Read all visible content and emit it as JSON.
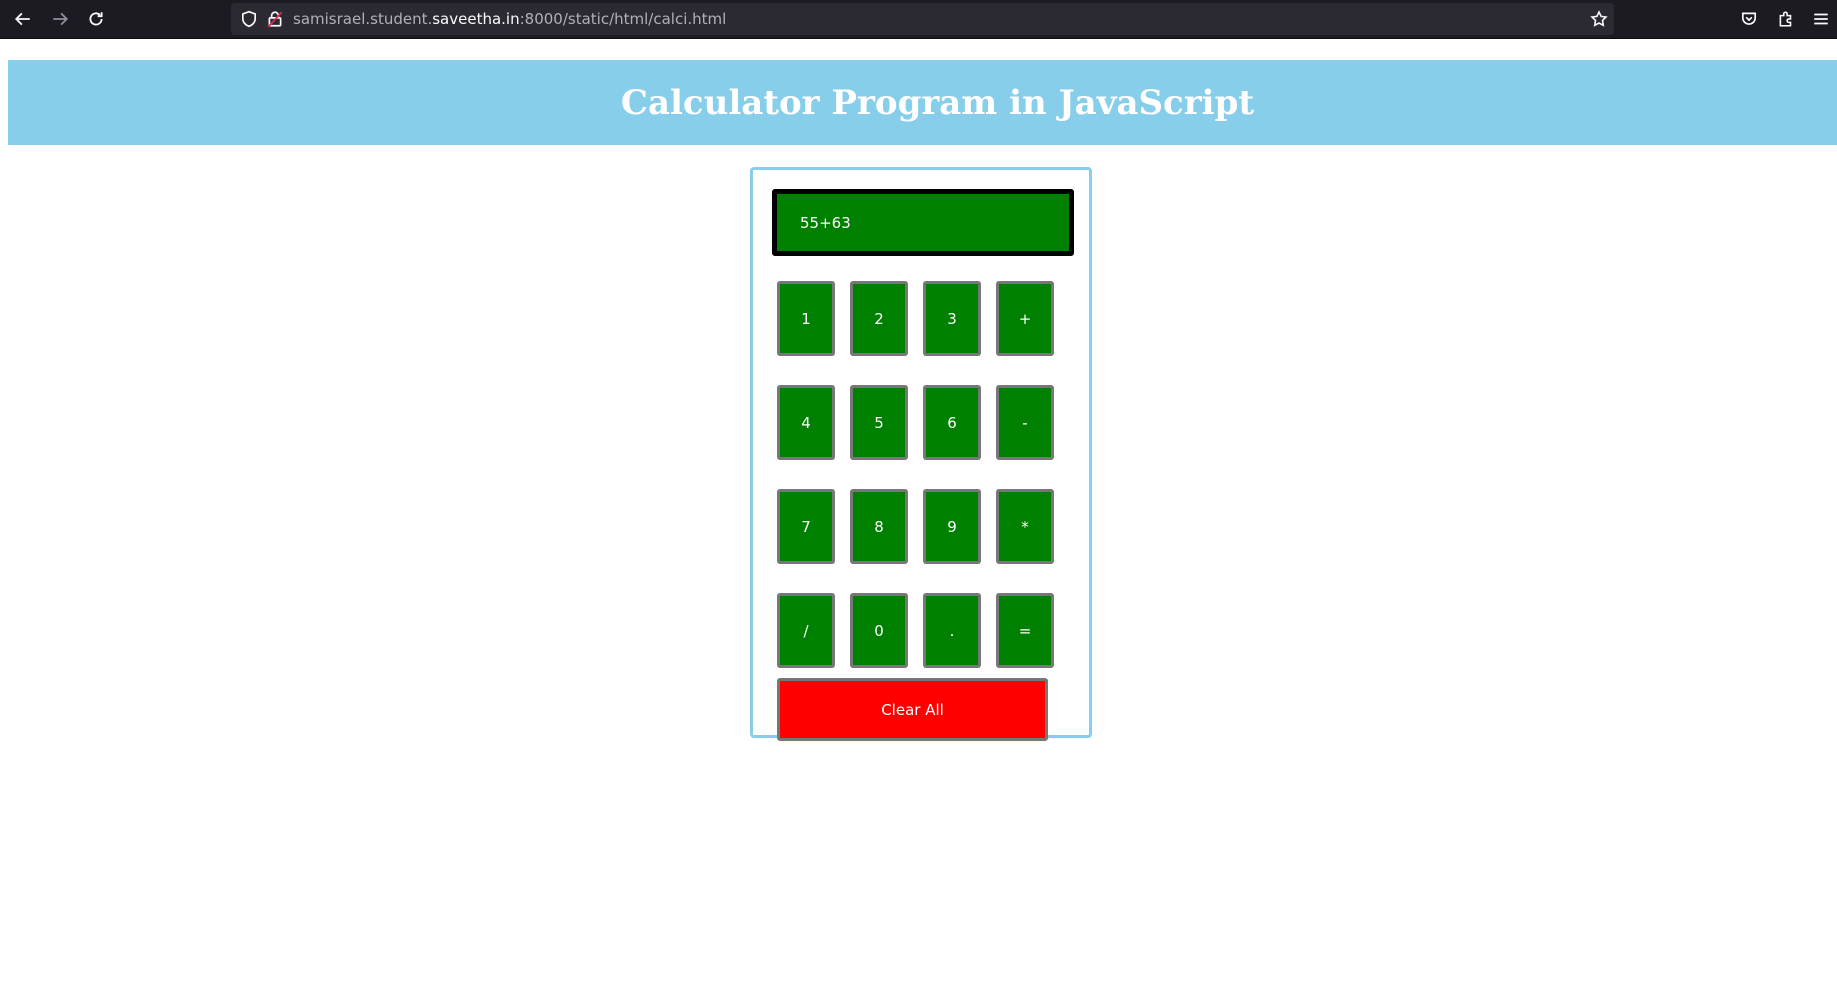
{
  "browser": {
    "url_prefix": "samisrael.student.",
    "url_domain": "saveetha.in",
    "url_suffix": ":8000/static/html/calci.html"
  },
  "page": {
    "title": "Calculator Program in JavaScript"
  },
  "calculator": {
    "display_value": "55+63",
    "keys": [
      {
        "label": "1",
        "name": "key-1"
      },
      {
        "label": "2",
        "name": "key-2"
      },
      {
        "label": "3",
        "name": "key-3"
      },
      {
        "label": "+",
        "name": "key-plus"
      },
      {
        "label": "4",
        "name": "key-4"
      },
      {
        "label": "5",
        "name": "key-5"
      },
      {
        "label": "6",
        "name": "key-6"
      },
      {
        "label": "-",
        "name": "key-minus"
      },
      {
        "label": "7",
        "name": "key-7"
      },
      {
        "label": "8",
        "name": "key-8"
      },
      {
        "label": "9",
        "name": "key-9"
      },
      {
        "label": "*",
        "name": "key-multiply"
      },
      {
        "label": "/",
        "name": "key-divide"
      },
      {
        "label": "0",
        "name": "key-0"
      },
      {
        "label": ".",
        "name": "key-decimal"
      },
      {
        "label": "=",
        "name": "key-equals"
      }
    ],
    "clear_label": "Clear All"
  },
  "colors": {
    "header_bg": "#87ceeb",
    "key_bg": "#008000",
    "clear_bg": "#ff0000",
    "display_border": "#000000"
  }
}
